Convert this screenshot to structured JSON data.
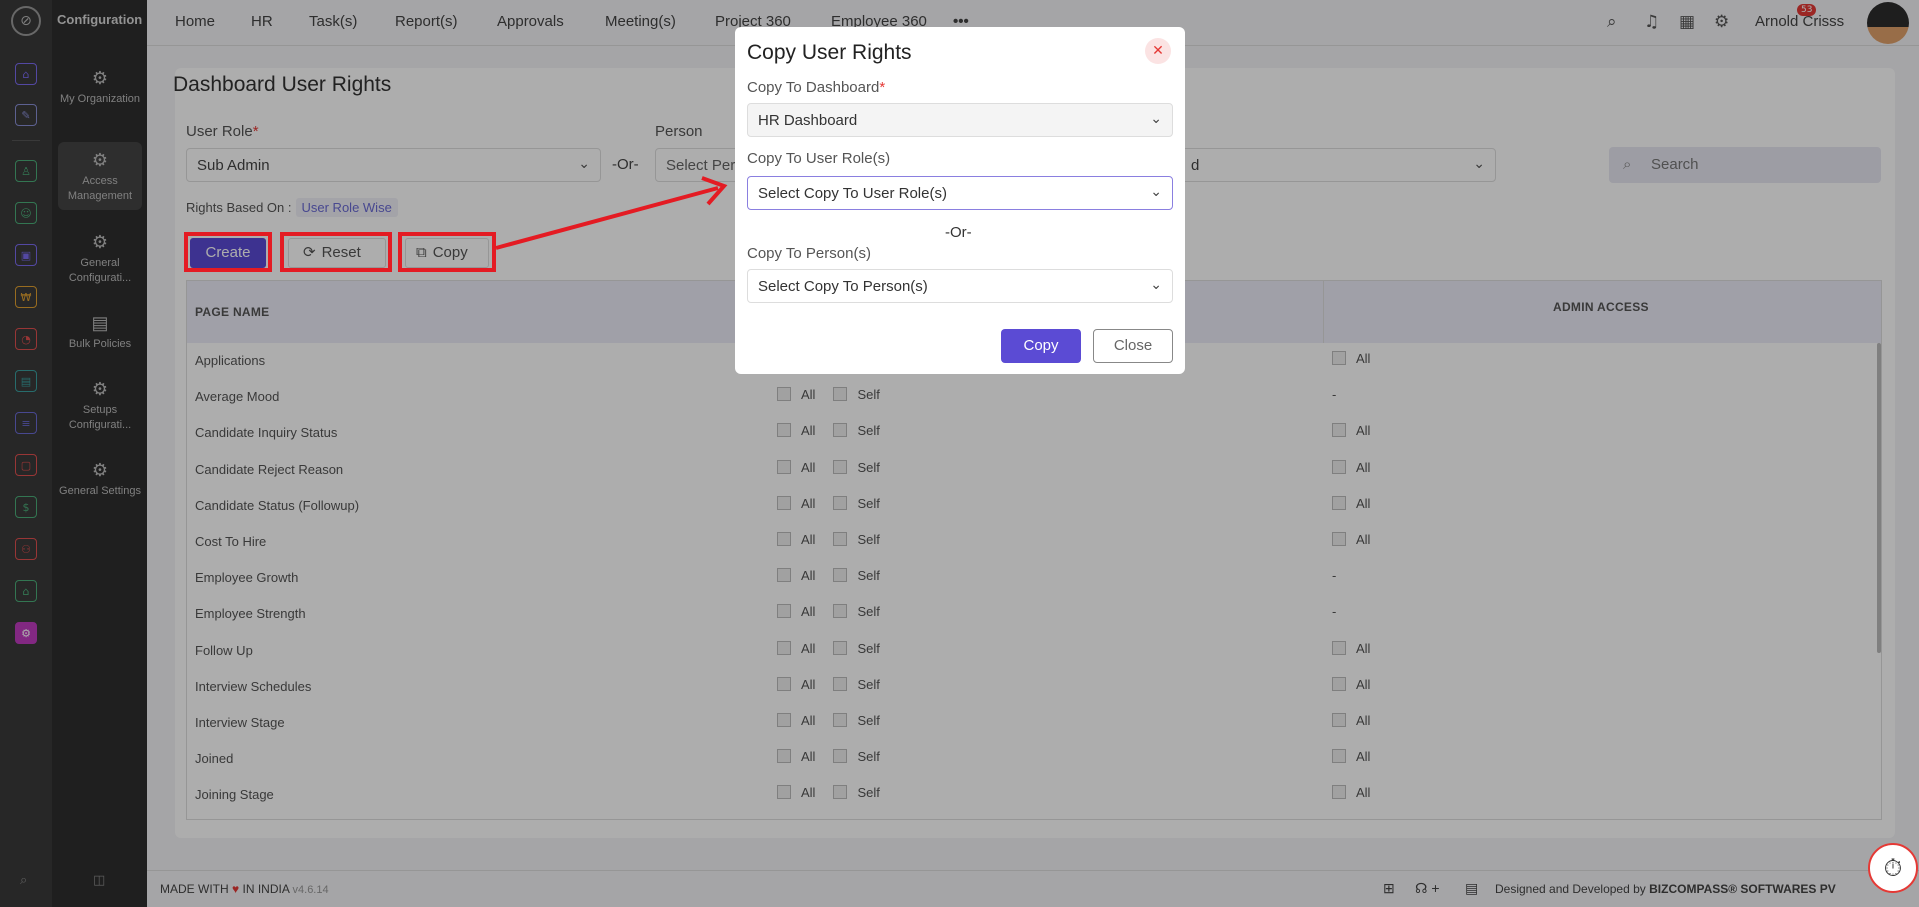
{
  "app": {
    "section_title": "Configuration",
    "logo_glyph": "⊘"
  },
  "config_sidebar": {
    "items": [
      {
        "label": "My Organization",
        "icon": "gear-cube-icon"
      },
      {
        "label": "Access Management",
        "icon": "gear-icon"
      },
      {
        "label": "General Configurati...",
        "icon": "gear-icon"
      },
      {
        "label": "Bulk Policies",
        "icon": "document-gear-icon"
      },
      {
        "label": "Setups Configurati...",
        "icon": "gear-icon"
      },
      {
        "label": "General Settings",
        "icon": "gear-cube-icon"
      }
    ]
  },
  "topnav": {
    "items": [
      "Home",
      "HR",
      "Task(s)",
      "Report(s)",
      "Approvals",
      "Meeting(s)",
      "Project 360",
      "Employee 360"
    ],
    "more": "•••",
    "notification_count": "53",
    "user_name": "Arnold Crisss"
  },
  "page": {
    "title": "Dashboard User Rights",
    "user_role_label": "User Role",
    "user_role_value": "Sub Admin",
    "or_text": "-Or-",
    "person_label": "Person",
    "person_placeholder": "Select Person",
    "dashboard_select_partial": "d",
    "search_placeholder": "Search",
    "rights_based_on_label": "Rights Based On :",
    "rights_based_on_value": "User Role Wise",
    "create_label": "Create",
    "reset_label": "Reset",
    "copy_label": "Copy"
  },
  "table": {
    "col_page_name": "PAGE NAME",
    "col_admin_access": "ADMIN ACCESS",
    "all_label": "All",
    "self_label": "Self",
    "dash": "-",
    "rows": [
      {
        "name": "Applications",
        "mid": false,
        "admin": "All"
      },
      {
        "name": "Average Mood",
        "mid": true,
        "admin": "-"
      },
      {
        "name": "Candidate Inquiry Status",
        "mid": true,
        "admin": "All"
      },
      {
        "name": "Candidate Reject Reason",
        "mid": true,
        "admin": "All"
      },
      {
        "name": "Candidate Status (Followup)",
        "mid": true,
        "admin": "All"
      },
      {
        "name": "Cost To Hire",
        "mid": true,
        "admin": "All"
      },
      {
        "name": "Employee Growth",
        "mid": true,
        "admin": "-"
      },
      {
        "name": "Employee Strength",
        "mid": true,
        "admin": "-"
      },
      {
        "name": "Follow Up",
        "mid": true,
        "admin": "All"
      },
      {
        "name": "Interview Schedules",
        "mid": true,
        "admin": "All"
      },
      {
        "name": "Interview Stage",
        "mid": true,
        "admin": "All"
      },
      {
        "name": "Joined",
        "mid": true,
        "admin": "All"
      },
      {
        "name": "Joining Stage",
        "mid": true,
        "admin": "All"
      }
    ]
  },
  "modal": {
    "title": "Copy User Rights",
    "copy_to_dashboard_label": "Copy To Dashboard",
    "copy_to_dashboard_value": "HR Dashboard",
    "copy_to_roles_label": "Copy To User Role(s)",
    "copy_to_roles_placeholder": "Select Copy To User Role(s)",
    "or_text": "-Or-",
    "copy_to_persons_label": "Copy To Person(s)",
    "copy_to_persons_placeholder": "Select Copy To Person(s)",
    "copy_button": "Copy",
    "close_button": "Close"
  },
  "footer": {
    "made_with": "MADE WITH",
    "heart": "♥",
    "in_india": "IN INDIA",
    "version": "v4.6.14",
    "designed_by": "Designed and Developed by",
    "company": "BIZCOMPASS® SOFTWARES PV"
  },
  "colors": {
    "accent": "#5b4bd4",
    "annotation_red": "#e41b23",
    "sidebar_dark": "#2e2e2e"
  }
}
